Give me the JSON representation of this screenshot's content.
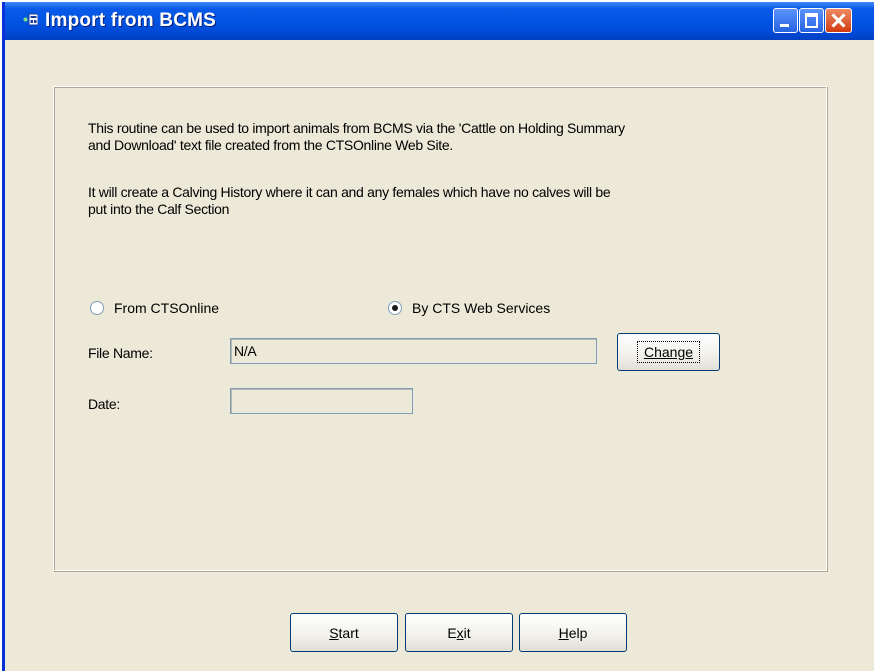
{
  "window": {
    "title": "Import from BCMS",
    "icon": "app-window-icon",
    "controls": {
      "minimize": "minimize-icon",
      "maximize": "maximize-icon",
      "close": "close-icon"
    }
  },
  "description": {
    "line1": "This routine can be used to import animals from BCMS via the 'Cattle on Holding Summary",
    "line2": "and Download' text file created from the CTSOnline Web Site.",
    "line3": "It will create a Calving History where it can and any females which have no calves will be",
    "line4": "put into the Calf Section"
  },
  "source": {
    "option1": "From CTSOnline",
    "option2": "By CTS Web Services",
    "selected": "By CTS Web Services"
  },
  "fields": {
    "file_name_label": "File Name:",
    "file_name_value": "N/A",
    "date_label": "Date:",
    "date_value": ""
  },
  "buttons": {
    "change": "Change",
    "start_u": "S",
    "start_rest": "tart",
    "exit_pre": "E",
    "exit_u": "x",
    "exit_rest": "it",
    "help_u": "H",
    "help_rest": "elp"
  },
  "colors": {
    "titlebar": "#0054e3",
    "dialog_bg": "#ece9d8",
    "button_border": "#003c74",
    "close_button": "#d23b10"
  }
}
